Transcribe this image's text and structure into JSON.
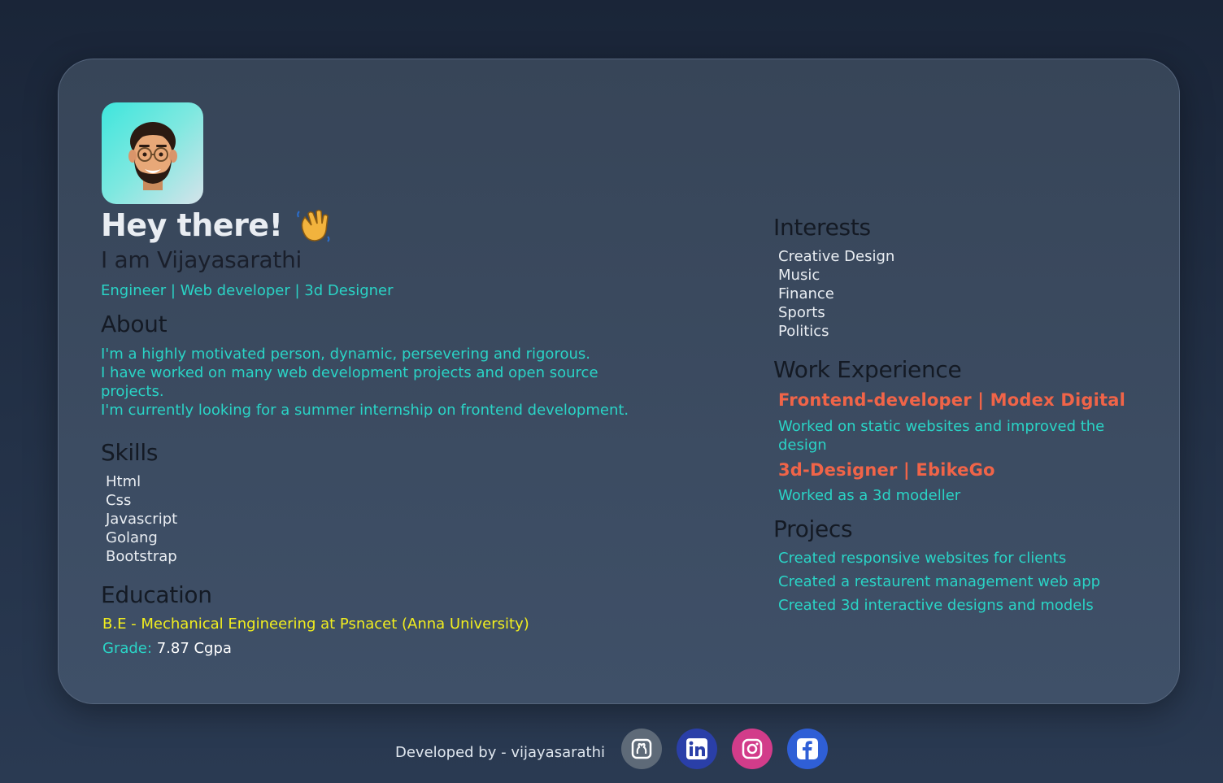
{
  "header": {
    "greeting": "Hey there!",
    "name": "I am Vijayasarathi",
    "roles": "Engineer | Web developer | 3d Designer"
  },
  "about": {
    "heading": "About",
    "lines": [
      "I'm a highly motivated person, dynamic, persevering and rigorous.",
      "I have worked on many web development projects and open source projects.",
      "I'm currently looking for a summer internship on frontend development."
    ]
  },
  "skills": {
    "heading": "Skills",
    "items": [
      "Html",
      "Css",
      "Javascript",
      "Golang",
      "Bootstrap"
    ]
  },
  "education": {
    "heading": "Education",
    "degree": "B.E - Mechanical Engineering at Psnacet (Anna University)",
    "grade_label": "Grade:",
    "grade_value": "7.87 Cgpa"
  },
  "interests": {
    "heading": "Interests",
    "items": [
      "Creative Design",
      "Music",
      "Finance",
      "Sports",
      "Politics"
    ]
  },
  "work": {
    "heading": "Work Experience",
    "jobs": [
      {
        "title": "Frontend-developer | Modex Digital",
        "desc": "Worked on static websites and improved the design"
      },
      {
        "title": "3d-Designer | EbikeGo",
        "desc": "Worked as a 3d modeller"
      }
    ]
  },
  "projects": {
    "heading": "Projecs",
    "items": [
      "Created responsive websites for clients",
      "Created a restaurent management web app",
      "Created 3d interactive designs and models"
    ]
  },
  "footer": {
    "text": "Developed by - vijayasarathi",
    "socials": [
      {
        "icon": "github-icon",
        "color": "#5e6a78"
      },
      {
        "icon": "linkedin-icon",
        "color": "#2a3fa8"
      },
      {
        "icon": "instagram-icon",
        "color": "#d23c8a"
      },
      {
        "icon": "facebook-icon",
        "color": "#2f5fd6"
      }
    ]
  },
  "colors": {
    "accent_teal": "#2ad4c6",
    "accent_orange": "#f06448",
    "accent_yellow": "#f2ee1e"
  }
}
